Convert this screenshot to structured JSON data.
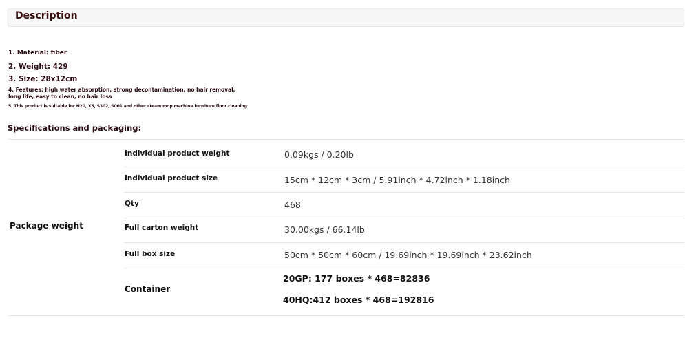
{
  "description": {
    "title": "Description",
    "features": [
      "1. Material: fiber",
      "2. Weight: 429",
      "3. Size: 28x12cm",
      "4. Features: high water absorption, strong decontamination, no hair removal, long life, easy to clean, no hair loss",
      "5. This product is suitable for H20, X5, S302, S001 and other steam mop machine furniture floor cleaning"
    ]
  },
  "specifications": {
    "heading": "Specifications and packaging:",
    "group_label": "Package weight",
    "rows": [
      {
        "label": "Individual product weight",
        "value": "0.09kgs / 0.20lb"
      },
      {
        "label": "Individual product size",
        "value": "15cm * 12cm * 3cm / 5.91inch * 4.72inch * 1.18inch"
      },
      {
        "label": "Qty",
        "value": "468"
      },
      {
        "label": "Full carton weight",
        "value": "30.00kgs / 66.14lb"
      },
      {
        "label": "Full box size",
        "value": "50cm * 50cm * 60cm / 19.69inch * 19.69inch * 23.62inch"
      }
    ],
    "container": {
      "label": "Container",
      "lines": [
        "20GP: 177 boxes * 468=82836",
        "40HQ:412 boxes * 468=192816"
      ]
    }
  }
}
